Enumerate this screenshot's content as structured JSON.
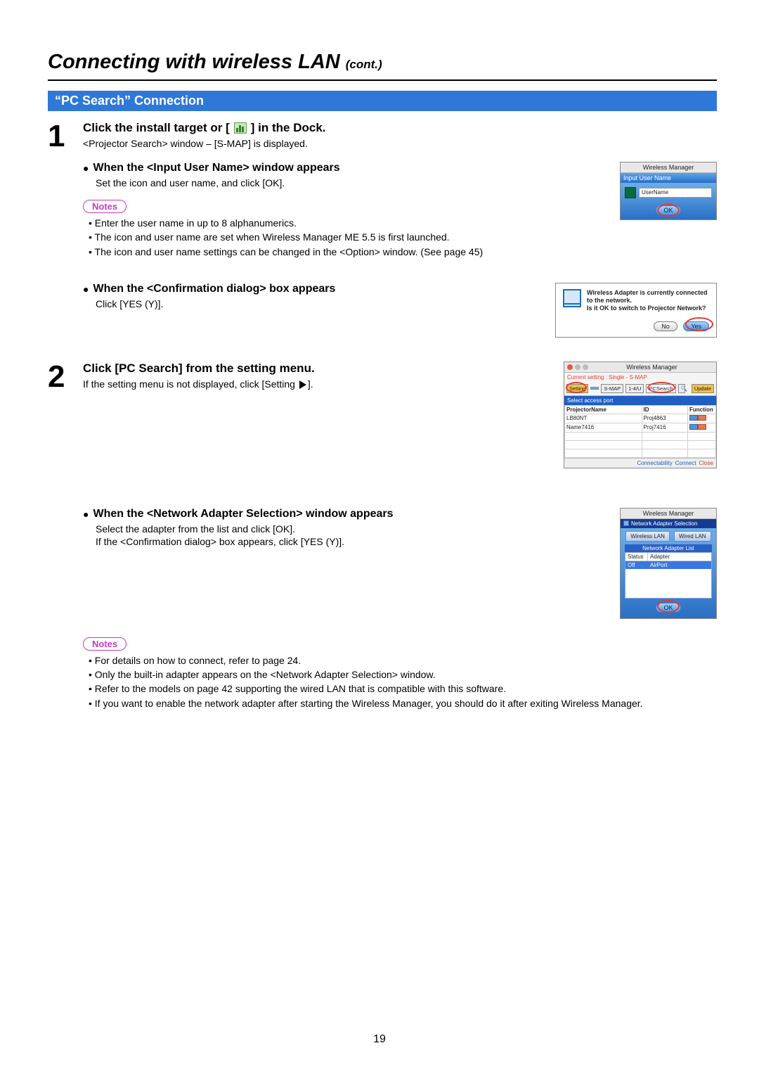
{
  "title": {
    "main": "Connecting with wireless LAN",
    "cont": "(cont.)"
  },
  "section_banner": "“PC Search” Connection",
  "step1": {
    "num": "1",
    "head_before": "Click the install target or [",
    "head_after": "] in the Dock.",
    "sub": "<Projector Search> window – [S-MAP] is displayed.",
    "sec1": {
      "head": "When the <Input User Name> window appears",
      "text": "Set the icon and user name, and click [OK]."
    },
    "notes_label": "Notes",
    "notes": [
      "Enter the user name in up to 8 alphanumerics.",
      "The icon and user name are set when Wireless Manager ME 5.5 is first launched.",
      "The icon and user name settings can be changed in the <Option> window. (See page 45)"
    ],
    "sec2": {
      "head": "When the <Confirmation dialog> box appears",
      "text": "Click [YES (Y)]."
    }
  },
  "step2": {
    "num": "2",
    "head": "Click [PC Search] from the setting menu.",
    "sub_before": "If the setting menu is not displayed, click [Setting ",
    "sub_after": "].",
    "sec1": {
      "head": "When the <Network Adapter Selection> window appears",
      "text1": "Select the adapter from the list and click [OK].",
      "text2": "If the <Confirmation dialog> box appears, click [YES (Y)]."
    },
    "notes_label": "Notes",
    "notes": [
      "For details on how to connect, refer to page 24.",
      "Only the built-in adapter appears on the <Network Adapter Selection> window.",
      "Refer to the models on page 42 supporting the wired LAN that is compatible with this software.",
      "If you want to enable the network adapter after starting the Wireless Manager, you should do it after exiting Wireless Manager."
    ]
  },
  "mock1": {
    "title": "Wireless Manager",
    "bar": "Input User Name",
    "placeholder": "UserName",
    "ok": "OK"
  },
  "mock2": {
    "line1": "Wireless Adapter is currently connected to the network.",
    "line2": "Is it OK to switch to Projector Network?",
    "no": "No",
    "yes": "Yes"
  },
  "mock3": {
    "title": "Wireless Manager",
    "status": "Current setting : Single - S-MAP",
    "tab_setting": "Setting",
    "tab_smap": "S-MAP",
    "tab_14": "1-4/U",
    "tab_pcsearch": "PCSearch",
    "update": "Update",
    "selhead": "Select access port",
    "col1": "ProjectorName",
    "col2": "ID",
    "col3": "Function",
    "r1c1": "LB80NT",
    "r1c2": "Proj4863",
    "r2c1": "Name7416",
    "r2c2": "Proj7416",
    "f1": "Connectability",
    "f2": "Connect",
    "f3": "Close"
  },
  "mock4": {
    "title": "Wireless Manager",
    "dark": "Network Adapter Selection",
    "t1": "Wireless LAN",
    "t2": "Wired LAN",
    "listhead": "Network Adapter List",
    "h1": "Status",
    "h2": "Adapter",
    "r1": "Off",
    "r2": "AirPort",
    "ok": "OK"
  },
  "page_number": "19"
}
